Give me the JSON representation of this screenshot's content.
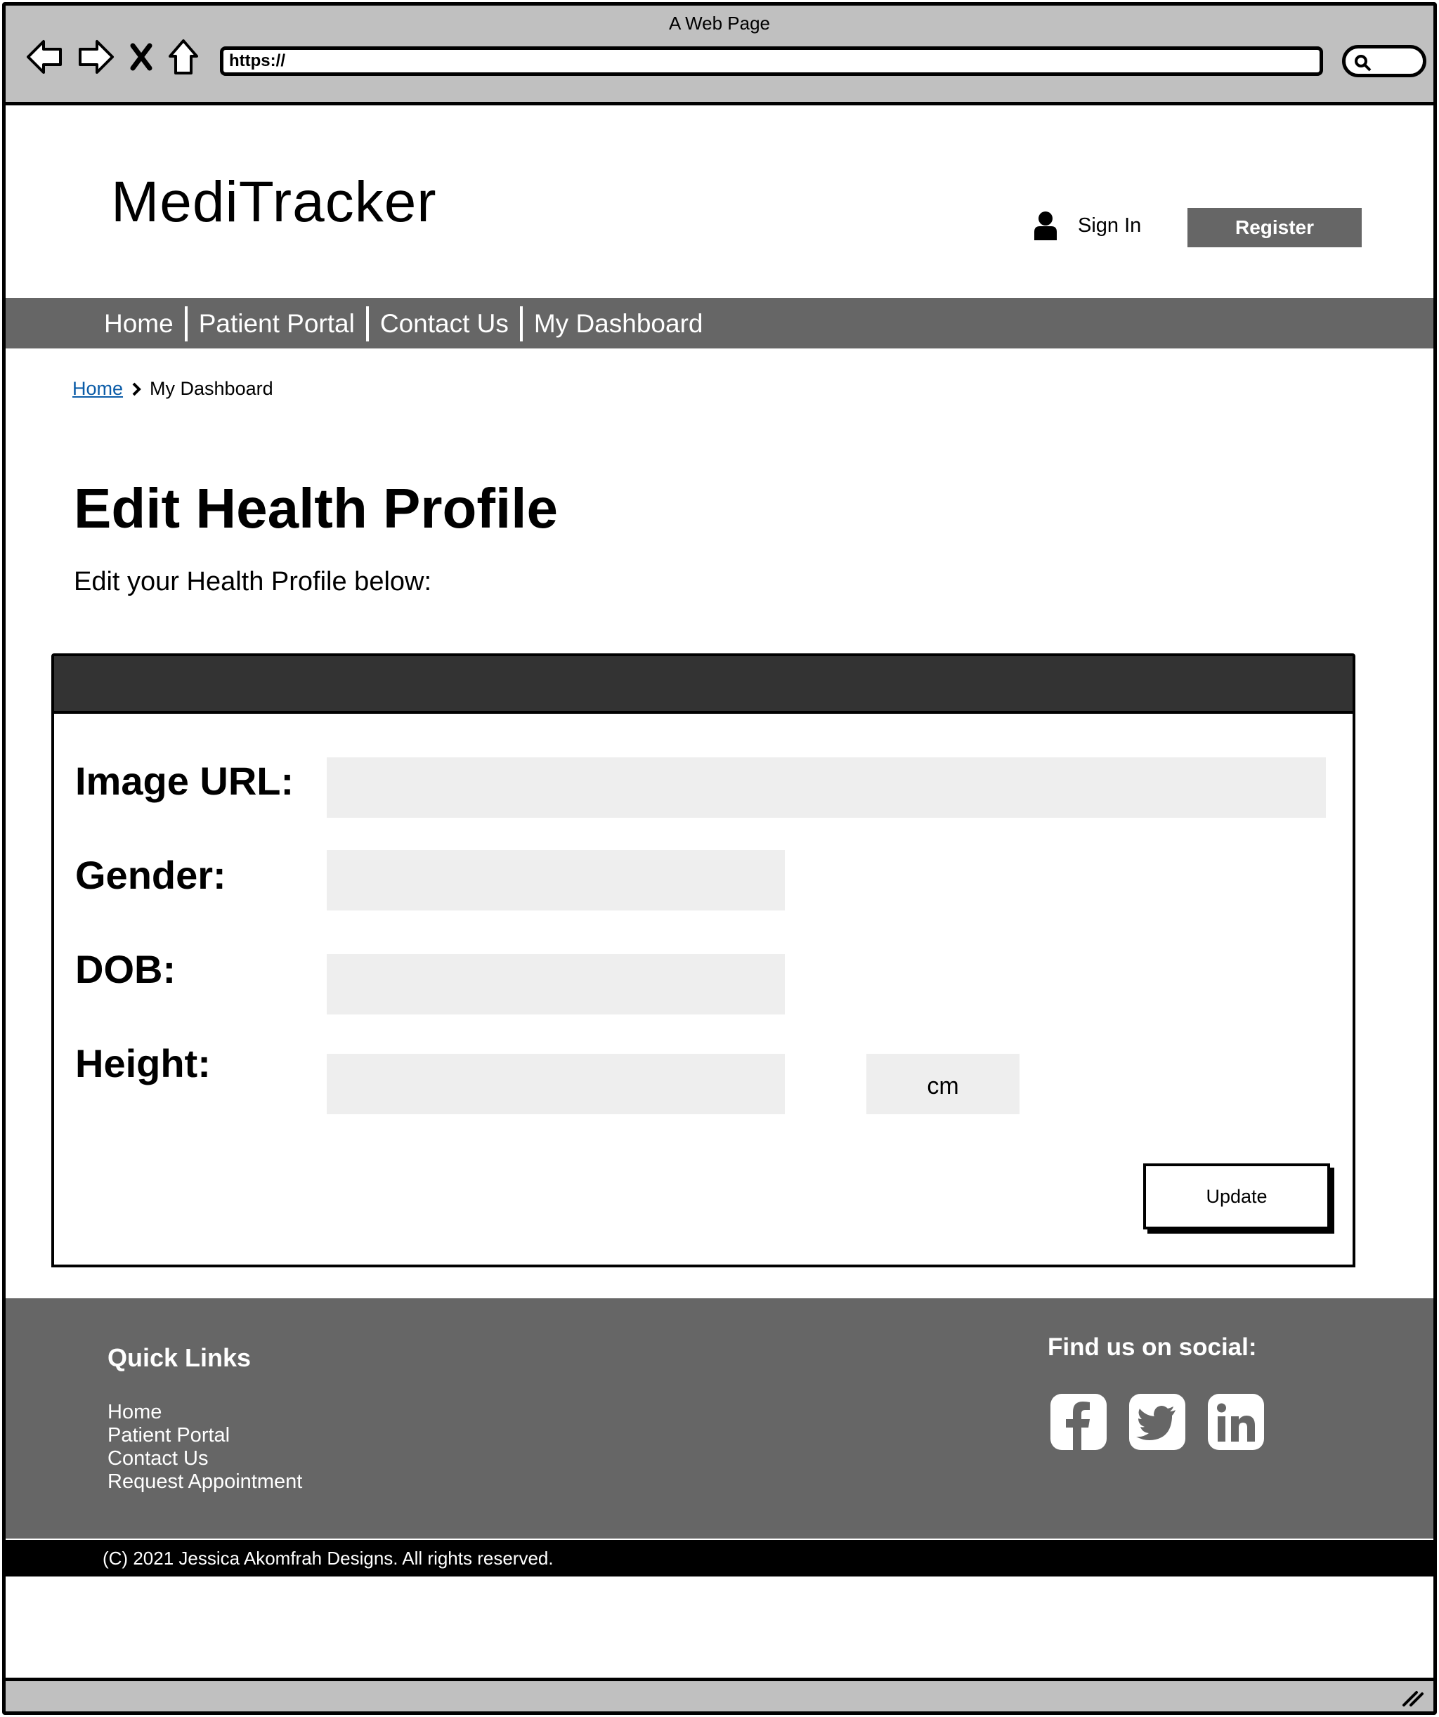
{
  "browser": {
    "window_title": "A Web Page",
    "url": "https://"
  },
  "header": {
    "brand": "MediTracker",
    "sign_in": "Sign In",
    "register": "Register"
  },
  "nav": {
    "items": [
      {
        "label": "Home"
      },
      {
        "label": "Patient Portal"
      },
      {
        "label": "Contact Us"
      },
      {
        "label": "My Dashboard"
      }
    ]
  },
  "breadcrumb": {
    "home": "Home",
    "current": "My Dashboard"
  },
  "page": {
    "title": "Edit Health Profile",
    "subtitle": "Edit your Health Profile below:"
  },
  "form": {
    "fields": [
      {
        "label": "Image URL:",
        "value": ""
      },
      {
        "label": "Gender:",
        "value": ""
      },
      {
        "label": "DOB:",
        "value": ""
      },
      {
        "label": "Height:",
        "value": ""
      }
    ],
    "height_unit": "cm",
    "update": "Update"
  },
  "footer": {
    "quick_links_title": "Quick Links",
    "quick_links": [
      "Home",
      "Patient Portal",
      "Contact Us",
      "Request Appointment"
    ],
    "social_title": "Find us on social:",
    "social_icons": [
      "facebook-icon",
      "twitter-icon",
      "linkedin-icon"
    ],
    "copyright": "(C) 2021 Jessica Akomfrah Designs. All rights reserved."
  },
  "colors": {
    "chrome": "#c0c0c0",
    "nav_bg": "#666666",
    "panel_header": "#333333",
    "input_bg": "#eeeeee",
    "link": "#0b5ca8"
  }
}
